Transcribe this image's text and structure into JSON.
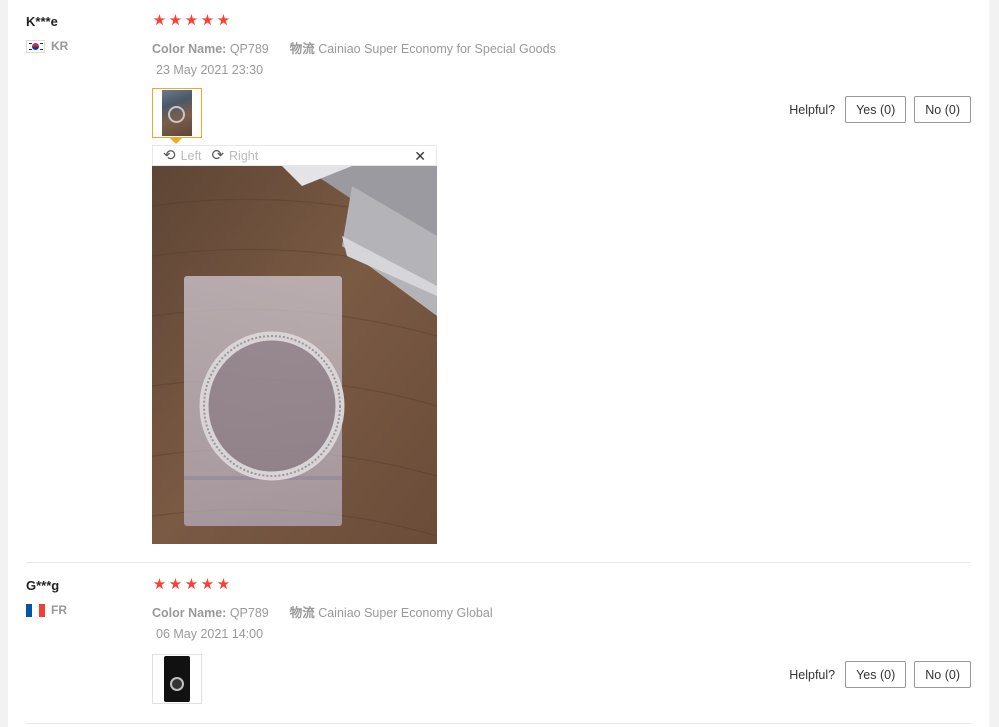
{
  "reviews": [
    {
      "user": "K***e",
      "country": "KR",
      "stars": 5,
      "color_label": "Color Name:",
      "color_value": "QP789",
      "ship_label": "物流",
      "ship_value": "Cainiao Super Economy for Special Goods",
      "date": "23 May 2021 23:30",
      "helpful_label": "Helpful?",
      "yes_label": "Yes (0)",
      "no_label": "No (0)"
    },
    {
      "user": "G***g",
      "country": "FR",
      "stars": 5,
      "color_label": "Color Name:",
      "color_value": "QP789",
      "ship_label": "物流",
      "ship_value": "Cainiao Super Economy Global",
      "date": "06 May 2021 14:00",
      "helpful_label": "Helpful?",
      "yes_label": "Yes (0)",
      "no_label": "No (0)"
    }
  ],
  "viewer": {
    "rotate_left_label": "Left",
    "rotate_right_label": "Right"
  },
  "icons": {
    "star": "star-icon",
    "rotate_left": "rotate-left-icon",
    "rotate_right": "rotate-right-icon",
    "close": "close-icon"
  },
  "colors": {
    "star": "#f44336",
    "thumb_active": "#f5a623"
  }
}
